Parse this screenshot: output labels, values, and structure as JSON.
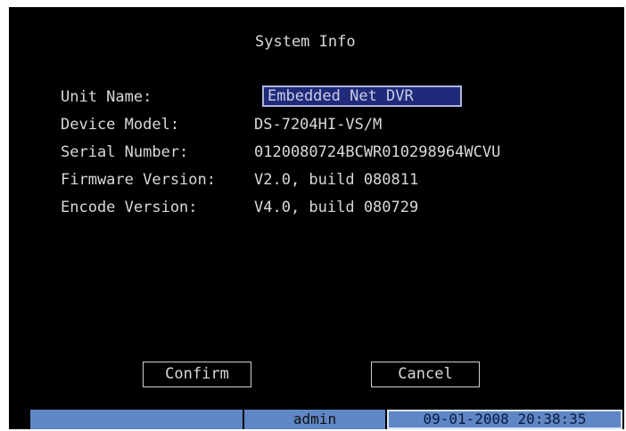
{
  "dialog": {
    "title": "System Info"
  },
  "fields": [
    {
      "label": "Unit Name:",
      "value": "Embedded Net DVR"
    },
    {
      "label": "Device Model:",
      "value": "DS-7204HI-VS/M"
    },
    {
      "label": "Serial Number:",
      "value": "0120080724BCWR010298964WCVU"
    },
    {
      "label": "Firmware Version:",
      "value": "V2.0, build 080811"
    },
    {
      "label": "Encode Version:",
      "value": "V4.0, build 080729"
    }
  ],
  "buttons": {
    "confirm": "Confirm",
    "cancel": "Cancel"
  },
  "status_bar": {
    "user": "admin",
    "datetime": "09-01-2008 20:38:35"
  },
  "colors": {
    "background": "#000000",
    "text": "#d9d9d9",
    "status_bar": "#5f86c5",
    "field_highlight": "#1f2a7a"
  }
}
